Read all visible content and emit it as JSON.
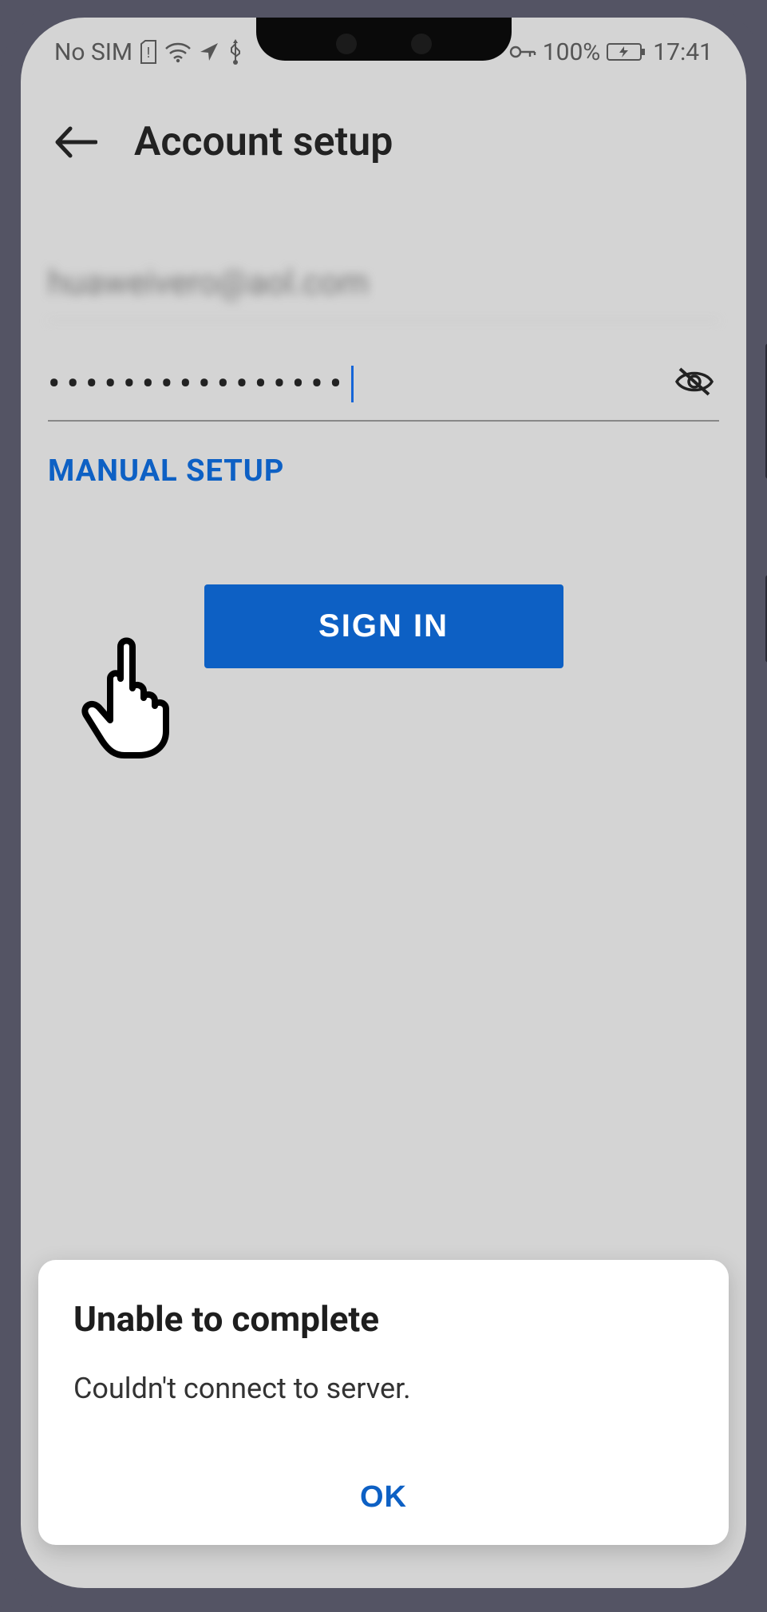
{
  "statusbar": {
    "sim": "No SIM",
    "battery_pct": "100%",
    "time": "17:41"
  },
  "header": {
    "title": "Account setup"
  },
  "form": {
    "email_value": "huaweivero@aol.com",
    "password_masked": "••••••••••••••••",
    "manual_setup_label": "MANUAL SETUP",
    "signin_label": "SIGN IN"
  },
  "dialog": {
    "title": "Unable to complete",
    "message": "Couldn't connect to server.",
    "ok_label": "OK"
  },
  "icons": {
    "back": "back-arrow",
    "eye_off": "eye-off",
    "sim_alert": "sim-alert",
    "wifi": "wifi",
    "location": "location-arrow",
    "usb": "usb",
    "vpn_key": "vpn-key",
    "battery": "battery-charging"
  }
}
